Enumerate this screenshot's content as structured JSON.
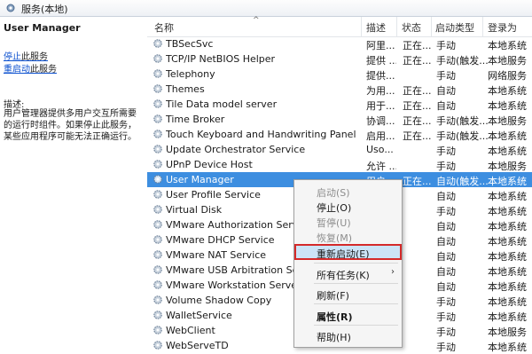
{
  "window": {
    "title": "服务(本地)",
    "icon": "services-gear-icon"
  },
  "left_pane": {
    "service_name": "User Manager",
    "stop_link": "停止",
    "stop_suffix": "此服务",
    "restart_link": "重启动",
    "restart_suffix": "此服务",
    "desc_label": "描述:",
    "description": "用户管理器提供多用户交互所需要的运行时组件。如果停止此服务，某些应用程序可能无法正确运行。"
  },
  "columns": {
    "name": "名称",
    "desc": "描述",
    "status": "状态",
    "startup": "启动类型",
    "logon": "登录为"
  },
  "services": [
    {
      "name": "TBSecSvc",
      "desc": "阿里...",
      "status": "正在...",
      "startup": "手动",
      "logon": "本地系统"
    },
    {
      "name": "TCP/IP NetBIOS Helper",
      "desc": "提供 ...",
      "status": "正在...",
      "startup": "手动(触发...",
      "logon": "本地服务"
    },
    {
      "name": "Telephony",
      "desc": "提供...",
      "status": "",
      "startup": "手动",
      "logon": "网络服务"
    },
    {
      "name": "Themes",
      "desc": "为用...",
      "status": "正在...",
      "startup": "自动",
      "logon": "本地系统"
    },
    {
      "name": "Tile Data model server",
      "desc": "用于...",
      "status": "正在...",
      "startup": "自动",
      "logon": "本地系统"
    },
    {
      "name": "Time Broker",
      "desc": "协调...",
      "status": "正在...",
      "startup": "手动(触发...",
      "logon": "本地服务"
    },
    {
      "name": "Touch Keyboard and Handwriting Panel Servi...",
      "desc": "启用...",
      "status": "正在...",
      "startup": "手动(触发...",
      "logon": "本地系统"
    },
    {
      "name": "Update Orchestrator Service",
      "desc": "Uso...",
      "status": "",
      "startup": "手动",
      "logon": "本地系统"
    },
    {
      "name": "UPnP Device Host",
      "desc": "允许 ...",
      "status": "",
      "startup": "手动",
      "logon": "本地服务"
    },
    {
      "name": "User Manager",
      "desc": "用户...",
      "status": "正在...",
      "startup": "自动(触发...",
      "logon": "本地系统",
      "selected": true
    },
    {
      "name": "User Profile Service",
      "desc": "",
      "status": "",
      "startup": "自动",
      "logon": "本地系统"
    },
    {
      "name": "Virtual Disk",
      "desc": "",
      "status": "",
      "startup": "手动",
      "logon": "本地系统"
    },
    {
      "name": "VMware Authorization Service",
      "desc": "",
      "status": "",
      "startup": "自动",
      "logon": "本地系统"
    },
    {
      "name": "VMware DHCP Service",
      "desc": "",
      "status": "",
      "startup": "自动",
      "logon": "本地系统"
    },
    {
      "name": "VMware NAT Service",
      "desc": "",
      "status": "",
      "startup": "自动",
      "logon": "本地系统"
    },
    {
      "name": "VMware USB Arbitration Servic...",
      "desc": "",
      "status": "",
      "startup": "自动",
      "logon": "本地系统"
    },
    {
      "name": "VMware Workstation Server",
      "desc": "",
      "status": "",
      "startup": "自动",
      "logon": "本地系统"
    },
    {
      "name": "Volume Shadow Copy",
      "desc": "",
      "status": "",
      "startup": "手动",
      "logon": "本地系统"
    },
    {
      "name": "WalletService",
      "desc": "",
      "status": "",
      "startup": "手动",
      "logon": "本地系统"
    },
    {
      "name": "WebClient",
      "desc": "",
      "status": "",
      "startup": "手动",
      "logon": "本地服务"
    },
    {
      "name": "WebServeTD",
      "desc": "",
      "status": "",
      "startup": "手动",
      "logon": "本地系统"
    }
  ],
  "context_menu": {
    "start": "启动(S)",
    "stop": "停止(O)",
    "pause": "暂停(U)",
    "resume": "恢复(M)",
    "restart": "重新启动(E)",
    "all_tasks": "所有任务(K)",
    "refresh": "刷新(F)",
    "properties": "属性(R)",
    "help": "帮助(H)"
  },
  "colors": {
    "selection": "#3d8ee0",
    "link": "#0a4fcf",
    "highlight_border": "#d42a2a"
  }
}
